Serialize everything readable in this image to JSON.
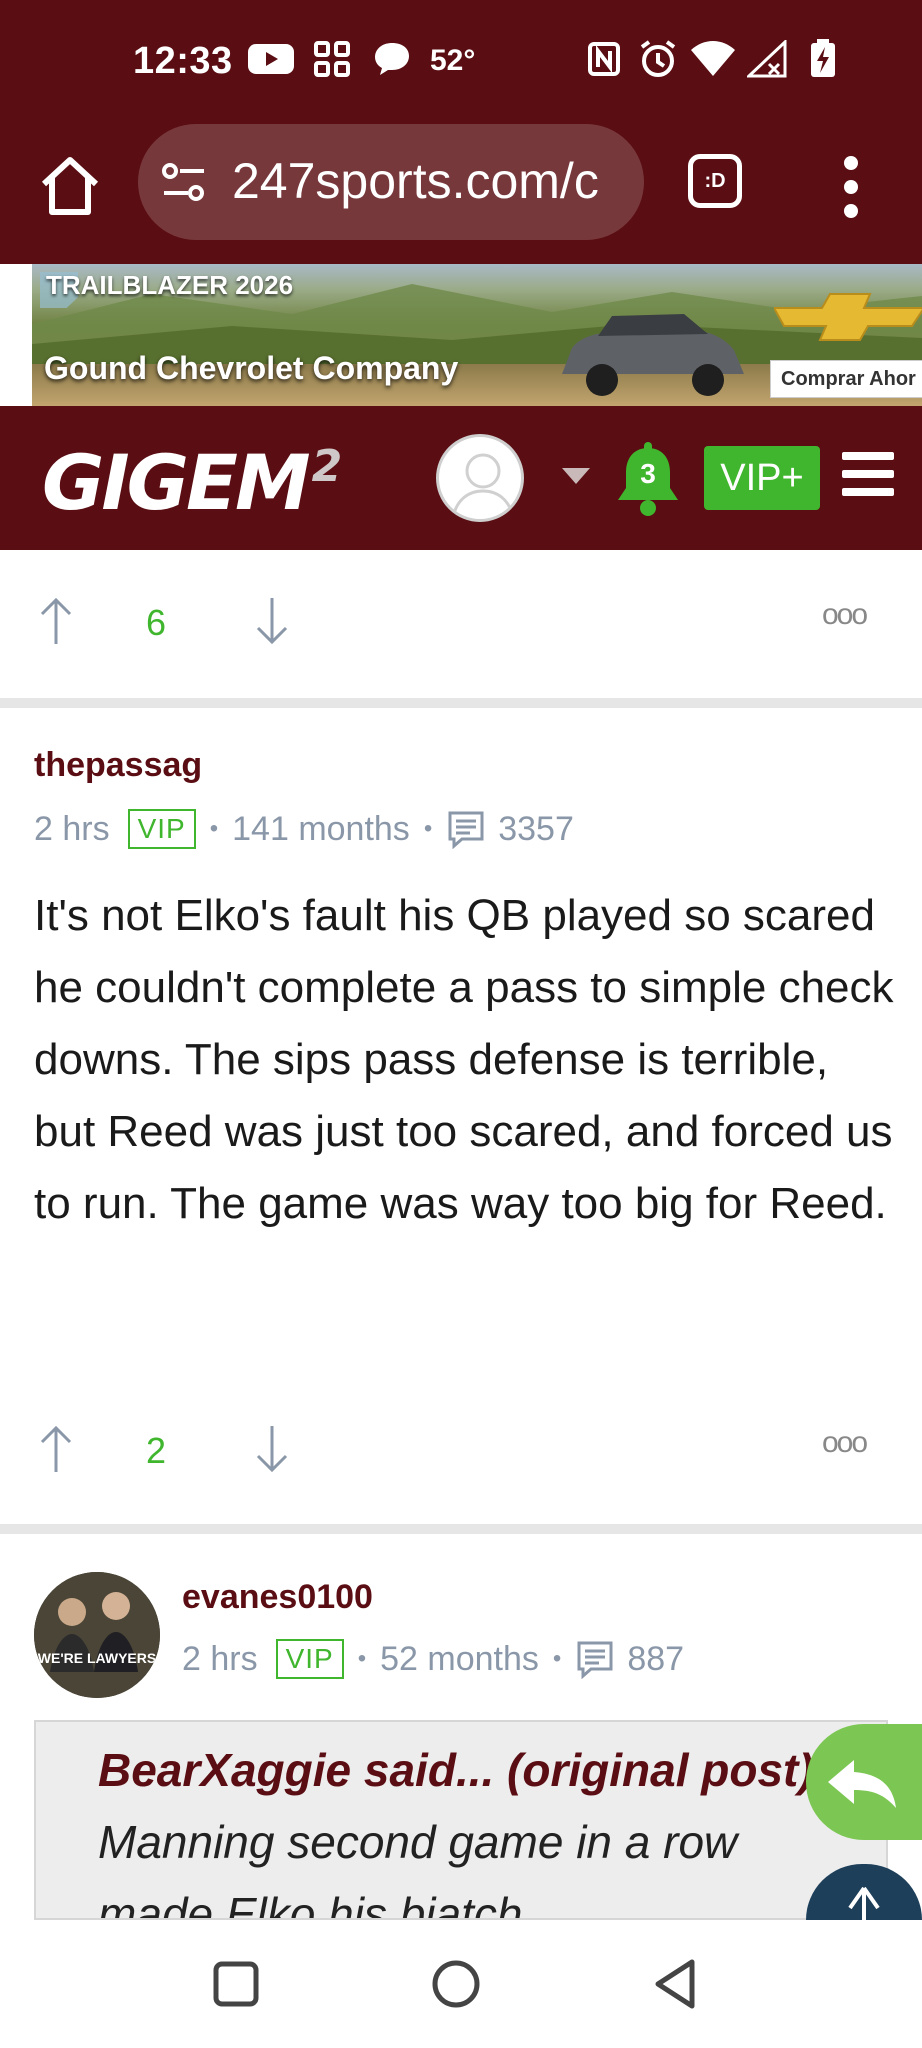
{
  "status_bar": {
    "time": "12:33",
    "temperature": "52°",
    "icons": [
      "youtube-icon",
      "qr-app-icon",
      "chat-bubble-icon",
      "nfc-icon",
      "alarm-icon",
      "wifi-icon",
      "signal-icon",
      "battery-charging-icon"
    ]
  },
  "browser": {
    "url": "247sports.com/c",
    "tab_label": ":D",
    "icons": [
      "home-icon",
      "site-settings-icon",
      "tab-switcher-icon",
      "more-menu-icon"
    ]
  },
  "ad": {
    "model": "TRAILBLAZER 2026",
    "dealer": "Gound Chevrolet Company",
    "cta": "Comprar Ahor"
  },
  "site_header": {
    "logo": "GIGEM",
    "logo_superscript": "2",
    "notification_count": "3",
    "vip_button": "VIP+"
  },
  "comments": [
    {
      "upvotes": "6"
    },
    {
      "author": "thepassag",
      "time": "2 hrs",
      "badge": "VIP",
      "tenure": "141 months",
      "post_count": "3357",
      "body": "It's not Elko's fault his QB played so scared he couldn't complete a pass to simple check downs. The sips pass defense is terrible, but Reed was just too scared, and forced us to run. The game was way too big for Reed.",
      "upvotes": "2"
    },
    {
      "author": "evanes0100",
      "avatar_caption": "WE'RE LAWYERS",
      "time": "2 hrs",
      "badge": "VIP",
      "tenure": "52 months",
      "post_count": "887",
      "quote_attribution": "BearXaggie said... (original post)",
      "quote_text": " Manning second game in a row made Elko his biatch"
    }
  ],
  "more_glyph": "ooo",
  "colors": {
    "maroon": "#5a0d12",
    "green": "#3fb62d",
    "meta_gray": "#8a97a8"
  }
}
